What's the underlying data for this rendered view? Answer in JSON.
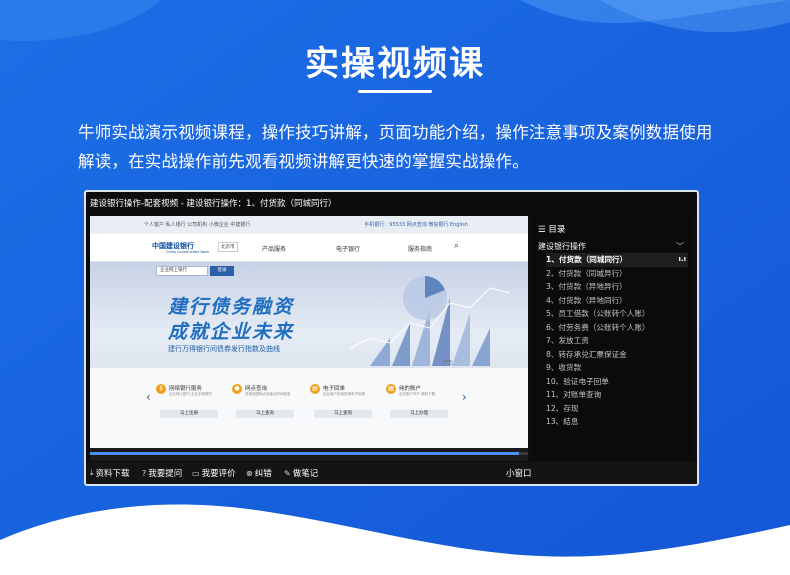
{
  "heading": {
    "title": "实操视频课",
    "intro": "牛师实战演示视频课程，操作技巧讲解，页面功能介绍，操作注意事项及案例数据使用解读，在实战操作前先观看视频讲解更快速的掌握实战操作。"
  },
  "player": {
    "title": "建设银行操作-配套视频 - 建设银行操作：1、付货款（同城同行）",
    "progress_fraction": 0.98,
    "toolbar": {
      "download": "资料下载",
      "ask": "我要提问",
      "review": "我要评价",
      "error": "纠错",
      "notes": "做笔记",
      "mini": "小窗口"
    },
    "toc": {
      "heading": "目录",
      "section": "建设银行操作",
      "items": [
        "1、付货款（同城同行）",
        "2、付货款（同城异行）",
        "3、付货款（异地异行）",
        "4、付货款（异地同行）",
        "5、员工借款（公账转个人账）",
        "6、付劳务费（公账转个人账）",
        "7、发放工资",
        "8、转存承兑汇票保证金",
        "9、收货款",
        "10、验证电子回单",
        "11、对账单查询",
        "12、存现",
        "13、結息"
      ]
    }
  },
  "bank_page": {
    "top_links": "个人客户   私人银行   公司机构   小微企业   中建银行",
    "top_right": "手机银行：95533   网点查询   微信银行   English",
    "logo": "中国建设银行",
    "logo_sub": "China Construction Bank",
    "region": "北京市",
    "nav": [
      "产品服务",
      "电子银行",
      "服务指南"
    ],
    "search_placeholder": "企业网上银行",
    "search_btn": "登录",
    "banner_line1": "建行债务融资",
    "banner_line2": "成就企业未来",
    "banner_line3": "建行万得银行间债券发行指数及曲线",
    "ad": "广告",
    "services": [
      {
        "title": "网络银行服务",
        "desc": "企业网上银行 企业手机银行",
        "btn": "马上注册"
      },
      {
        "title": "网点查询",
        "desc": "查询全国网点及营业时间信息",
        "btn": "马上查询"
      },
      {
        "title": "电子回单",
        "desc": "企业用户在线查询电子回单",
        "btn": "马上查询"
      },
      {
        "title": "纯的账户",
        "desc": "企业账户开户 资料下载",
        "btn": "马上办理"
      }
    ]
  }
}
